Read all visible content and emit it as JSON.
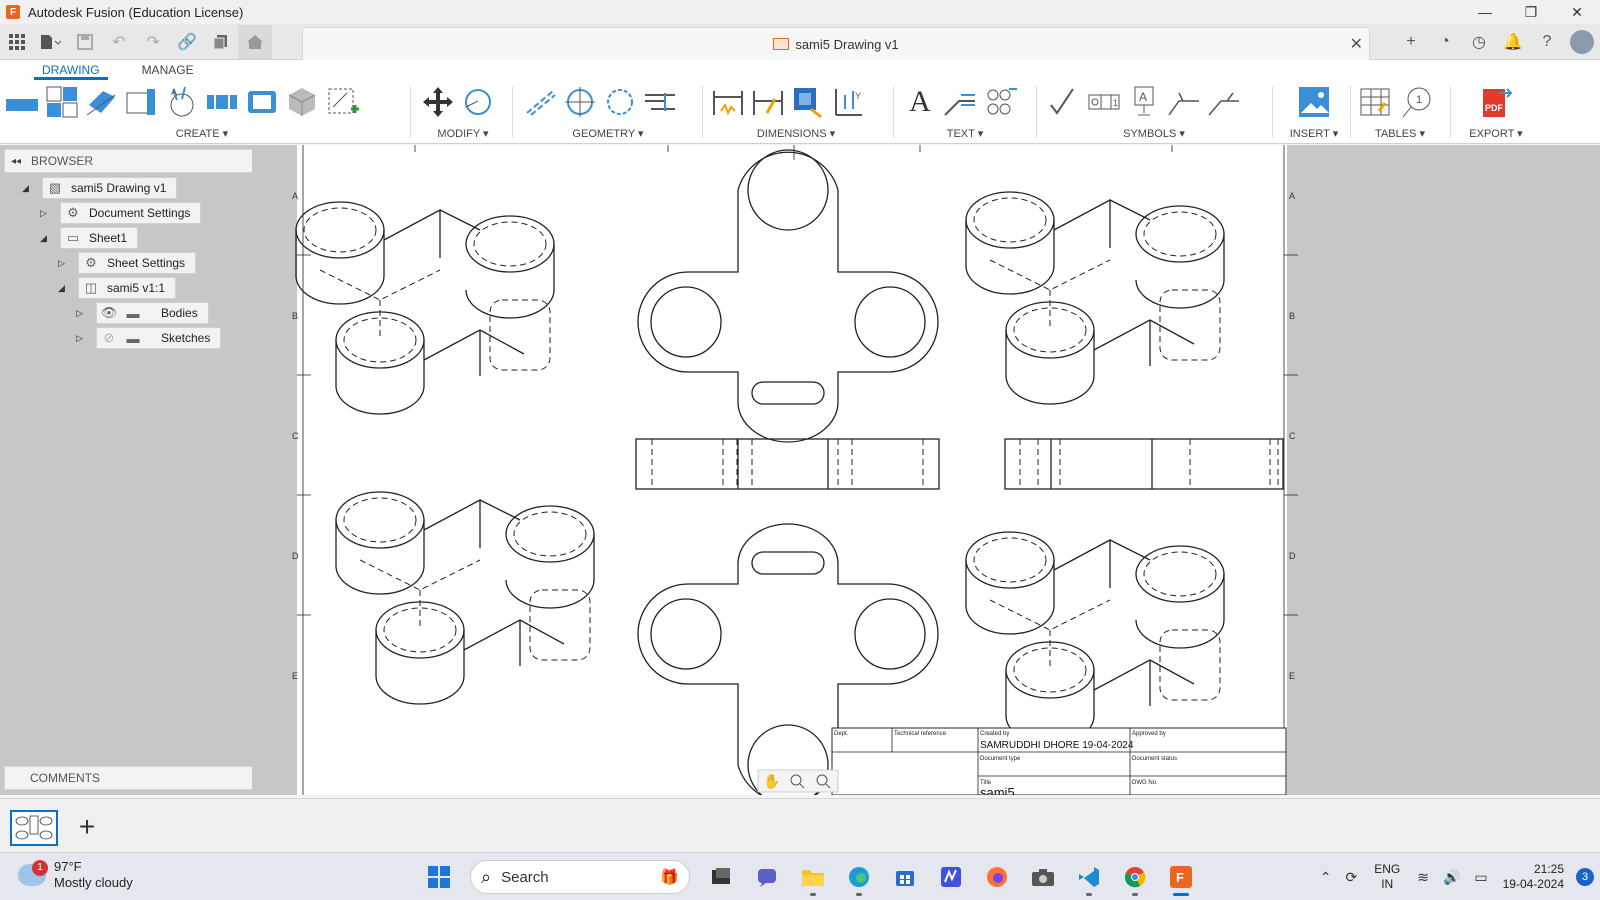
{
  "window": {
    "title": "Autodesk Fusion (Education License)",
    "minimize": "—",
    "restore": "❐",
    "close": "✕"
  },
  "document": {
    "tab_title": "sami5 Drawing v1",
    "close": "✕"
  },
  "ribbon": {
    "tabs": [
      {
        "label": "DRAWING",
        "active": true
      },
      {
        "label": "MANAGE",
        "active": false
      }
    ],
    "groups": {
      "create": "CREATE ▾",
      "modify": "MODIFY ▾",
      "geometry": "GEOMETRY ▾",
      "dimensions": "DIMENSIONS ▾",
      "text": "TEXT ▾",
      "symbols": "SYMBOLS ▾",
      "insert": "INSERT ▾",
      "tables": "TABLES ▾",
      "export": "EXPORT ▾"
    }
  },
  "browser": {
    "header": "BROWSER",
    "nodes": [
      {
        "label": "sami5 Drawing v1"
      },
      {
        "label": "Document Settings"
      },
      {
        "label": "Sheet1"
      },
      {
        "label": "Sheet Settings"
      },
      {
        "label": "sami5 v1:1"
      },
      {
        "label": "Bodies"
      },
      {
        "label": "Sketches"
      }
    ],
    "comments": "COMMENTS"
  },
  "drawing": {
    "zone_rows": [
      "A",
      "B",
      "C",
      "D",
      "E"
    ],
    "title_block": {
      "dept_label": "Dept.",
      "tech_ref_label": "Technical reference",
      "created_by_label": "Created by",
      "created_by_value": "SAMRUDDHI DHORE 19-04-2024",
      "approved_by_label": "Approved by",
      "doc_type_label": "Document type",
      "doc_status_label": "Document status",
      "title_label": "Title",
      "dwg_no_label": "DWG No.",
      "title_value": "sami5"
    }
  },
  "taskbar": {
    "weather": {
      "temp": "97°F",
      "desc": "Mostly cloudy",
      "badge": "1"
    },
    "search_label": "Search",
    "lang_line1": "ENG",
    "lang_line2": "IN",
    "time": "21:25",
    "date": "19-04-2024",
    "notifications": "3"
  },
  "colors": {
    "accent": "#0a6fc2",
    "fusion_orange": "#e8661e",
    "canvas_bg": "#c7c7c7"
  }
}
